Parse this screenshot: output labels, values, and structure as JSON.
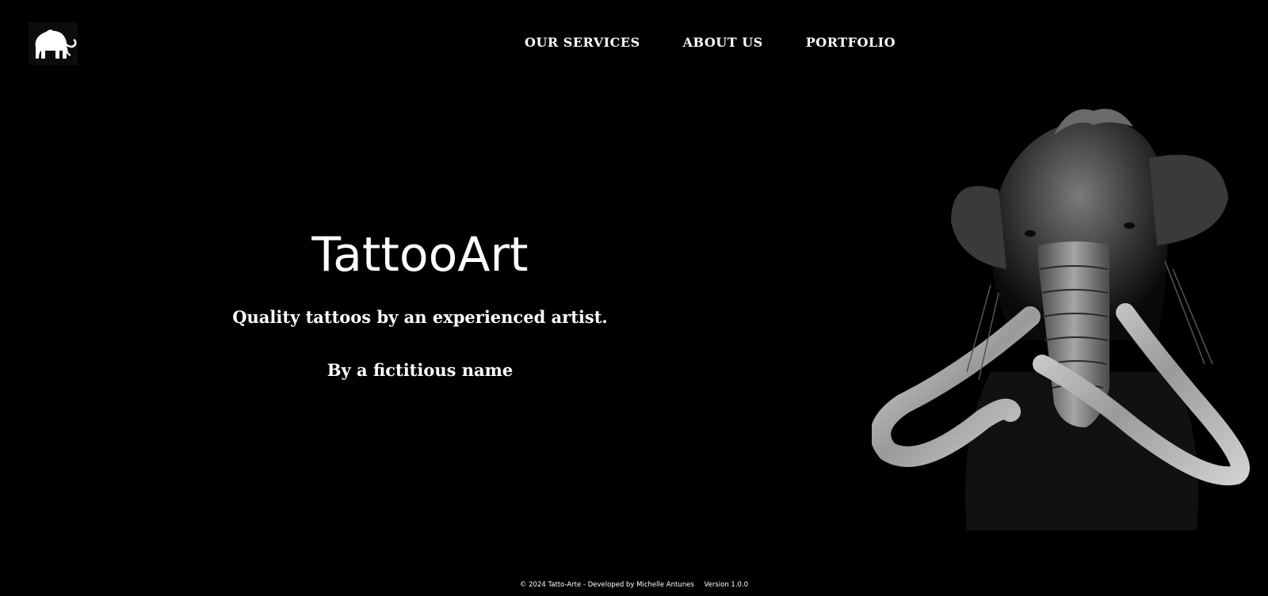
{
  "header": {
    "logo_icon": "mammoth-icon",
    "nav": [
      {
        "label": "OUR SERVICES"
      },
      {
        "label": "ABOUT US"
      },
      {
        "label": "PORTFOLIO"
      }
    ]
  },
  "hero": {
    "title": "TattooArt",
    "tagline": "Quality tattoos by an experienced artist.",
    "author": "By a fictitious name",
    "image_icon": "mammoth-illustration"
  },
  "footer": {
    "copyright": "© 2024 Tatto-Arte - Developed by Michelle Antunes",
    "version": "Version 1.0.0"
  },
  "colors": {
    "background": "#000000",
    "text": "#ffffff"
  }
}
